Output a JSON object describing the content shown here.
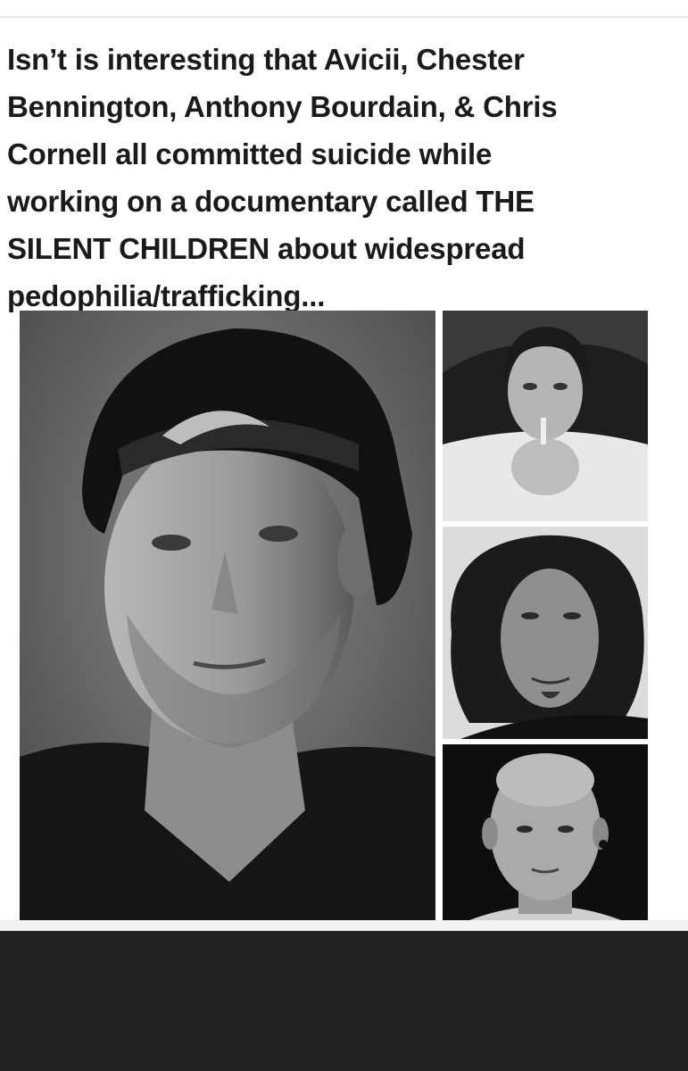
{
  "post": {
    "text_lines": [
      "Isn’t is interesting that Avicii, Chester",
      "Bennington, Anthony Bourdain, & Chris",
      "Cornell all committed suicide while",
      "working on a documentary called THE",
      "SILENT CHILDREN about widespread",
      "pedophilia/trafficking..."
    ]
  },
  "colors": {
    "text": "#1a1a1a",
    "bottom_bar": "#222325",
    "background": "#ffffff"
  }
}
